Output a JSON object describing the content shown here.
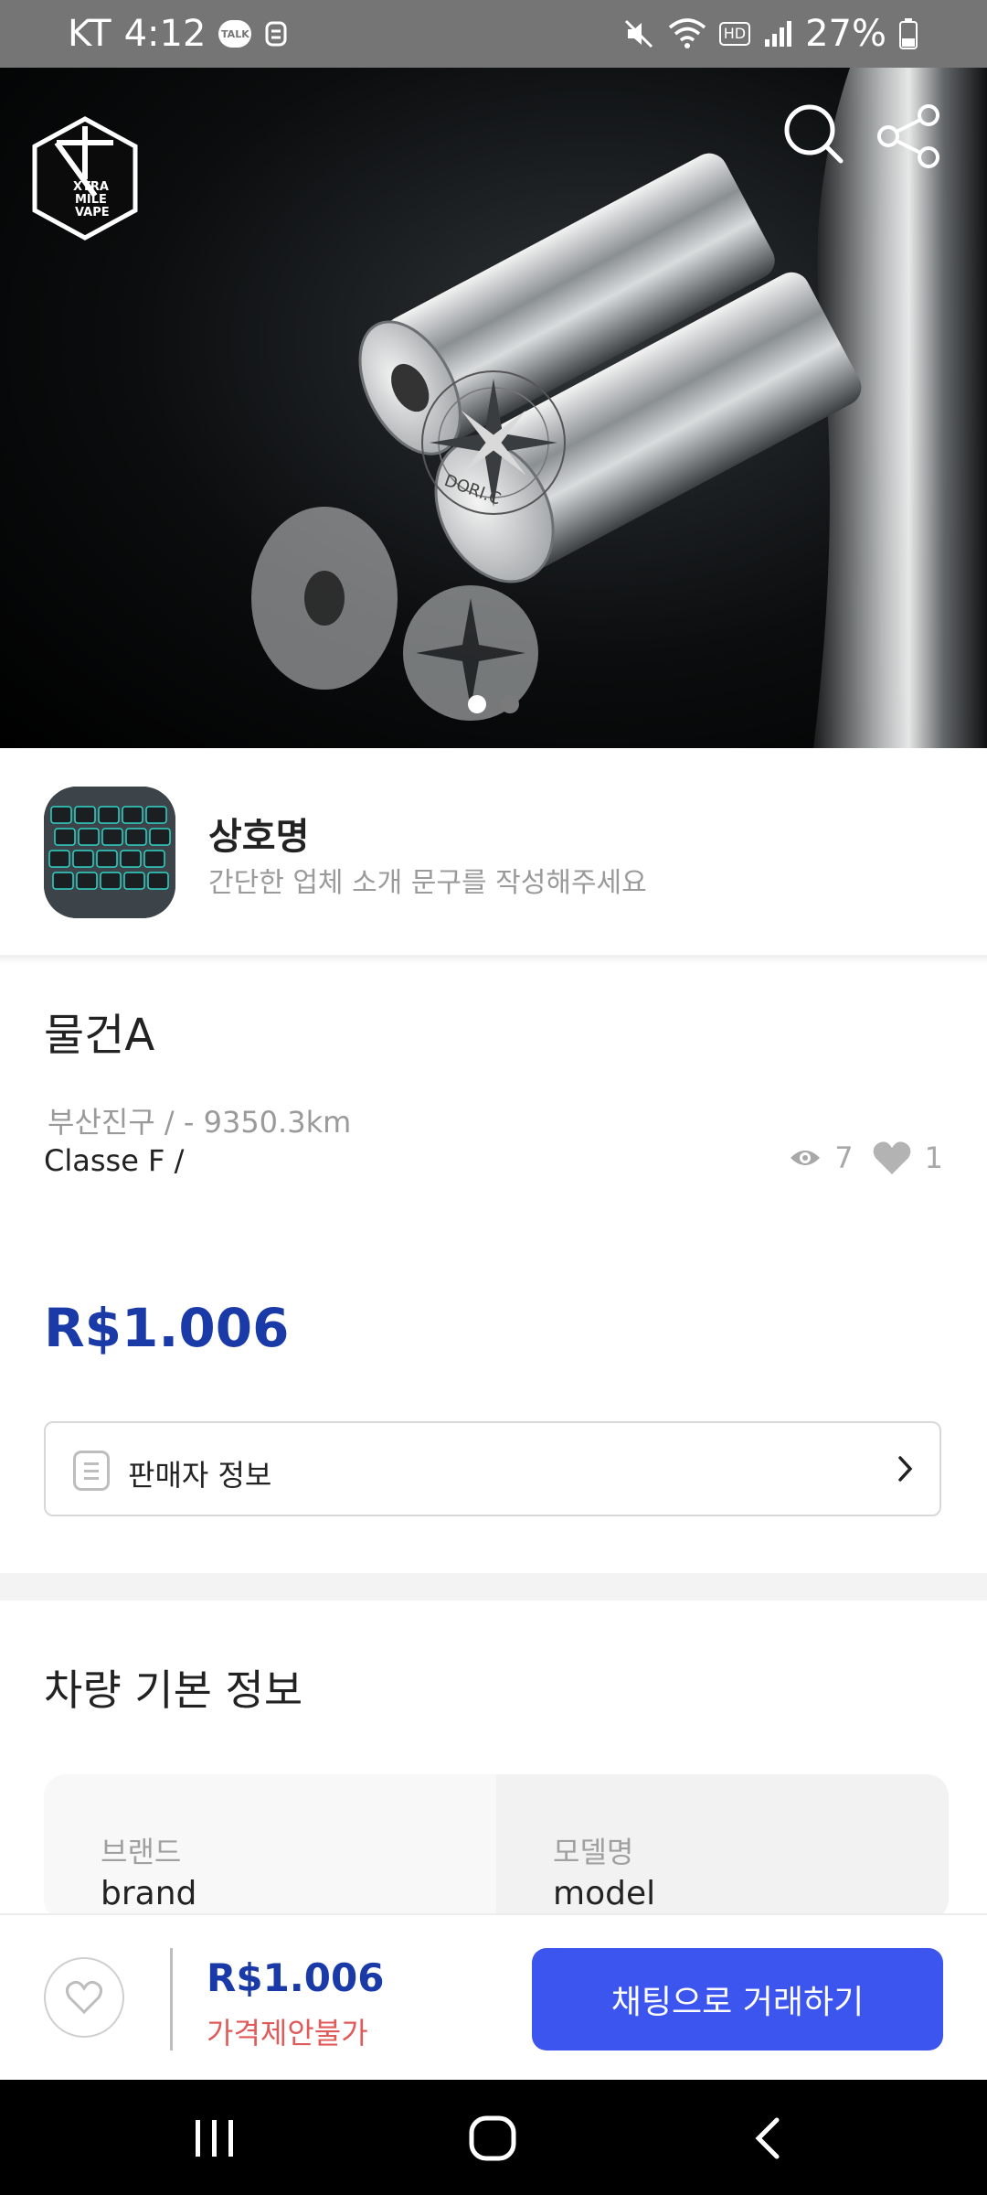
{
  "status_bar": {
    "carrier": "KT",
    "time": "4:12",
    "talk_badge": "TALK",
    "hd_label": "HD",
    "battery": "27%"
  },
  "hero": {
    "brand_logo_text": [
      "XTRA",
      "MILE",
      "VAPE"
    ],
    "product_engraving": "DORI.C",
    "slide_total": 2,
    "slide_active": 1
  },
  "store": {
    "name": "상호명",
    "description": "간단한 업체 소개 문구를 작성해주세요"
  },
  "product": {
    "title": "물건A",
    "location": "부산진구 / - 9350.3km",
    "grade": "Classe F /",
    "views": "7",
    "likes": "1",
    "price": "R$1.006"
  },
  "seller_info": {
    "label": "판매자 정보"
  },
  "basic_info": {
    "title": "차량 기본 정보",
    "fields": [
      {
        "label": "브랜드",
        "value": "brand"
      },
      {
        "label": "모델명",
        "value": "model"
      }
    ]
  },
  "bottom_bar": {
    "price": "R$1.006",
    "negotiation": "가격제안불가",
    "chat_button": "채팅으로 거래하기"
  },
  "colors": {
    "price_blue": "#1a3aa8",
    "cta_blue": "#3d55ef",
    "nego_red": "#e05a5a",
    "status_bar": "#757575"
  },
  "icons": [
    "search-icon",
    "share-icon",
    "eye-icon",
    "heart-icon",
    "document-icon",
    "chevron-right-icon",
    "recents-icon",
    "home-icon",
    "back-icon"
  ]
}
